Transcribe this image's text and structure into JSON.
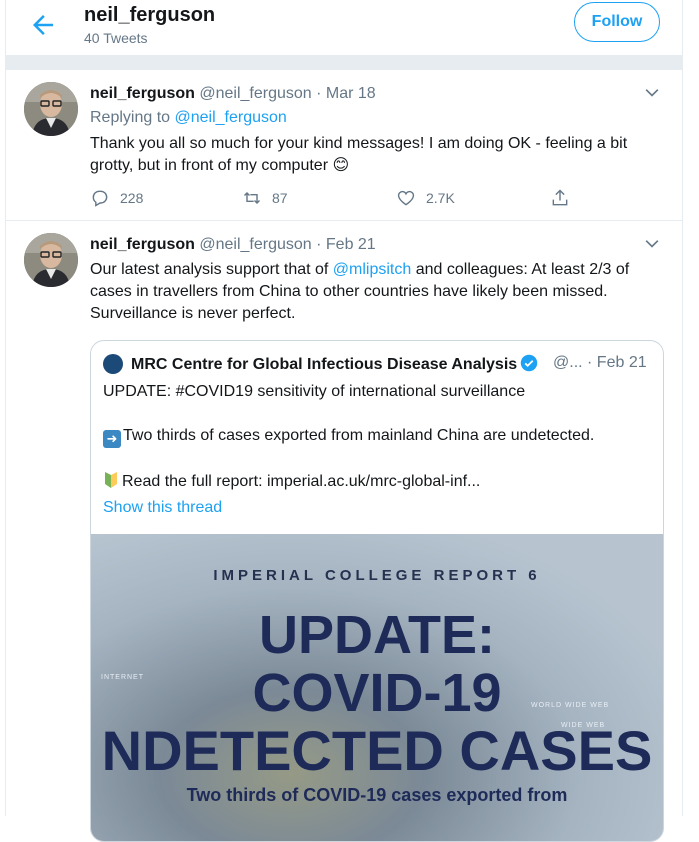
{
  "header": {
    "name": "neil_ferguson",
    "tweet_count": "40 Tweets",
    "follow_label": "Follow"
  },
  "tweets": [
    {
      "name": "neil_ferguson",
      "meta": "@neil_ferguson · Mar 18",
      "replying_label": "Replying to",
      "replying_handle": "@neil_ferguson",
      "text": "Thank you all so much for your kind messages! I am doing OK - feeling a bit grotty, but in front of my computer",
      "emoji": "😊",
      "replies": "228",
      "retweets": "87",
      "likes": "2.7K"
    },
    {
      "name": "neil_ferguson",
      "meta": "@neil_ferguson · Feb 21",
      "text_before": "Our latest analysis support that of",
      "mention": "@mlipsitch",
      "text_after": "and colleagues: At least 2/3 of cases in travellers from China to other countries have likely been missed. Surveillance is never perfect.",
      "quote": {
        "name": "MRC Centre for Global Infectious Disease Analysis",
        "meta": "@... · Feb 21",
        "line1": "UPDATE: #COVID19 sensitivity of international surveillance",
        "line2": "Two thirds of cases exported from mainland China are undetected.",
        "line3": "Read the full report: imperial.ac.uk/mrc-global-inf...",
        "show_thread": "Show this thread",
        "media": {
          "kicker": "IMPERIAL COLLEGE REPORT 6",
          "line1": "UPDATE:",
          "line2": "COVID-19",
          "line3": "NDETECTED CASES",
          "sub": "Two thirds of COVID-19 cases exported from"
        }
      }
    }
  ],
  "colors": {
    "accent": "#1da1f2",
    "text": "#14171a",
    "muted": "#657786",
    "border": "#e6ecf0"
  }
}
